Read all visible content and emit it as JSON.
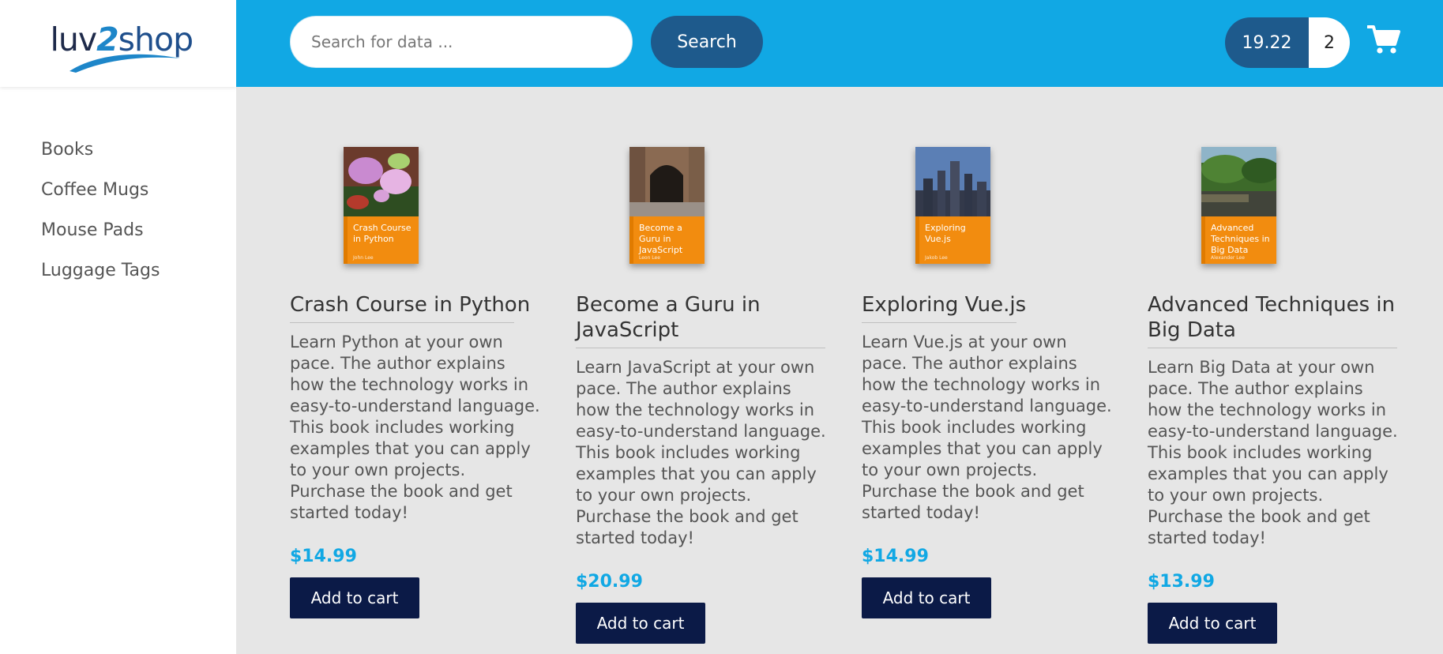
{
  "logo": {
    "luv": "luv",
    "two": "2",
    "shop": "shop"
  },
  "categories": [
    {
      "label": "Books"
    },
    {
      "label": "Coffee Mugs"
    },
    {
      "label": "Mouse Pads"
    },
    {
      "label": "Luggage Tags"
    }
  ],
  "search": {
    "placeholder": "Search for data ...",
    "button_label": "Search"
  },
  "cart": {
    "total": "19.22",
    "quantity": "2",
    "icon": "shopping-cart-icon"
  },
  "colors": {
    "header": "#11a8e4",
    "button_dark": "#1e5a8c",
    "add_to_cart": "#0b1a47",
    "price": "#11a8e4",
    "cover_band": "#f28c0f"
  },
  "products": [
    {
      "name": "Crash Course in Python",
      "cover_title": "Crash Course in Python",
      "cover_author": "John Lee",
      "description": "Learn Python at your own pace. The author explains how the technology works in easy-to-understand language. This book includes working examples that you can apply to your own projects. Purchase the book and get started today!",
      "price": "$14.99",
      "button_label": "Add to cart"
    },
    {
      "name": "Become a Guru in JavaScript",
      "cover_title": "Become a Guru in JavaScript",
      "cover_author": "Leon Lee",
      "description": "Learn JavaScript at your own pace. The author explains how the technology works in easy-to-understand language. This book includes working examples that you can apply to your own projects. Purchase the book and get started today!",
      "price": "$20.99",
      "button_label": "Add to cart"
    },
    {
      "name": "Exploring Vue.js",
      "cover_title": "Exploring Vue.js",
      "cover_author": "Jakob Lee",
      "description": "Learn Vue.js at your own pace. The author explains how the technology works in easy-to-understand language. This book includes working examples that you can apply to your own projects. Purchase the book and get started today!",
      "price": "$14.99",
      "button_label": "Add to cart"
    },
    {
      "name": "Advanced Techniques in Big Data",
      "cover_title": "Advanced Techniques in Big Data",
      "cover_author": "Alexander Lee",
      "description": "Learn Big Data at your own pace. The author explains how the technology works in easy-to-understand language. This book includes working examples that you can apply to your own projects. Purchase the book and get started today!",
      "price": "$13.99",
      "button_label": "Add to cart"
    }
  ]
}
